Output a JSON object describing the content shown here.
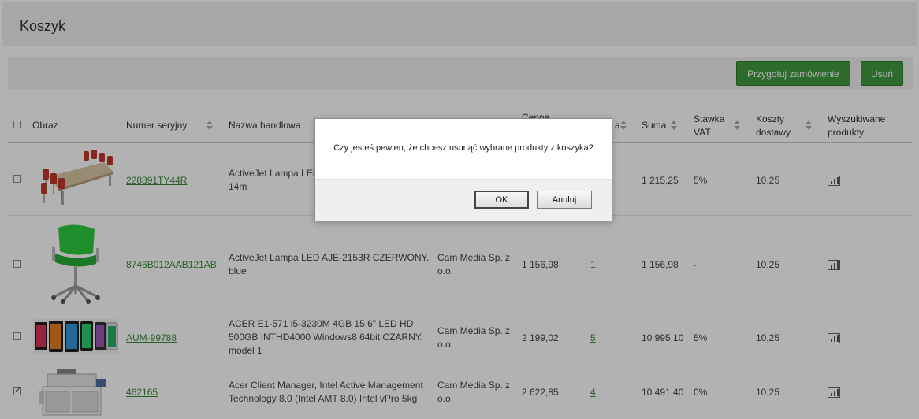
{
  "page": {
    "title": "Koszyk"
  },
  "toolbar": {
    "prepare_label": "Przygotuj zamówienie",
    "delete_label": "Usuń"
  },
  "table": {
    "headers": {
      "image": "Obraz",
      "serial": "Numer seryjny",
      "trade_name": "Nazwa handlowa",
      "price": "Cenna",
      "quantity": "a",
      "sum": "Suma",
      "vat_l1": "Stawka",
      "vat_l2": "VAT",
      "shipping_l1": "Koszty",
      "shipping_l2": "dostawy",
      "search_l1": "Wyszukiwane",
      "search_l2": "produkty"
    },
    "rows": [
      {
        "checked": false,
        "serial": "228891TY44R",
        "name_l1": "ActiveJet Lampa LED",
        "name_l2": "14m",
        "supplier_l1": "",
        "supplier_l2": "",
        "price": "",
        "quantity": "",
        "sum": "1 215,25",
        "vat": "5%",
        "shipping": "10,25",
        "image_icon": "conference-table-image"
      },
      {
        "checked": false,
        "serial": "8746B012AAB121AB",
        "name_l1": "ActiveJet Lampa LED AJE-2153R CZERWONY.",
        "name_l2": "blue",
        "supplier_l1": "Cam Media Sp. z",
        "supplier_l2": "o.o.",
        "price": "1 156,98",
        "quantity": "1",
        "sum": "1 156,98",
        "vat": "-",
        "shipping": "10,25",
        "image_icon": "green-chair-image"
      },
      {
        "checked": false,
        "serial": "AUM-99788",
        "name_l1": "ACER E1-571 i5-3230M 4GB 15,6\" LED HD",
        "name_l2": "500GB INTHD4000 Windows8 64bit CZARNY.",
        "name_l3": "model 1",
        "supplier_l1": "Cam Media Sp. z",
        "supplier_l2": "o.o.",
        "price": "2 199,02",
        "quantity": "5",
        "sum": "10 995,10",
        "vat": "5%",
        "shipping": "10,25",
        "image_icon": "smartphones-image"
      },
      {
        "checked": true,
        "serial": "462165",
        "name_l1": "Acer Client Manager, Intel Active Management",
        "name_l2": "Technology 8.0 (Intel AMT 8.0) Intel vPro 5kg",
        "supplier_l1": "Cam Media Sp. z",
        "supplier_l2": "o.o.",
        "price": "2 622,85",
        "quantity": "4",
        "sum": "10 491,40",
        "vat": "0%",
        "shipping": "10,25",
        "image_icon": "copier-image"
      }
    ]
  },
  "dialog": {
    "message": "Czy jesteś pewien, że chcesz usunąć wybrane produkty z koszyka?",
    "ok_label": "OK",
    "cancel_label": "Anuluj"
  }
}
